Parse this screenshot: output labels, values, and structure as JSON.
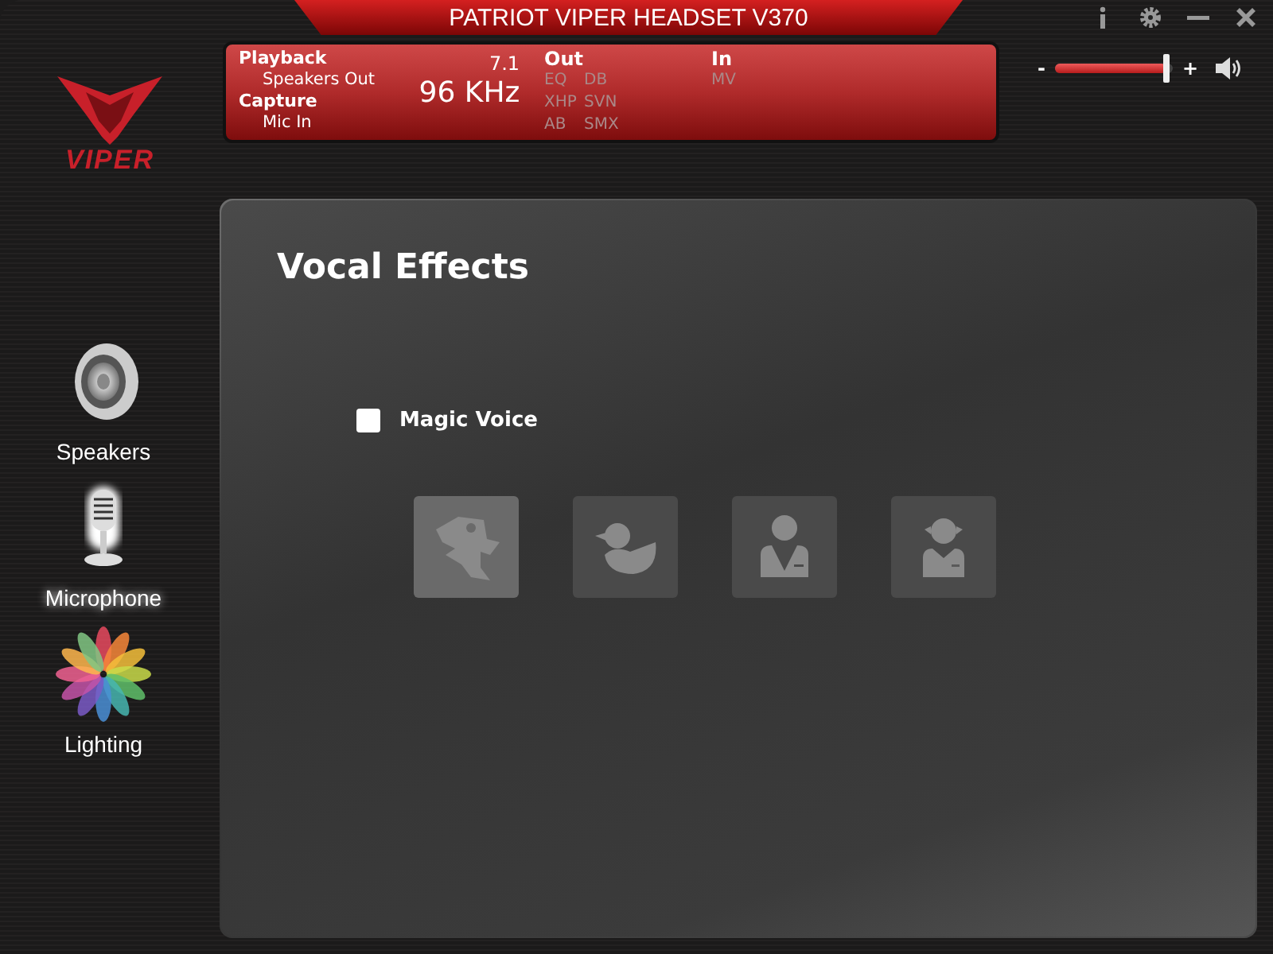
{
  "window": {
    "title": "PATRIOT VIPER HEADSET V370",
    "logo_text": "VIPER"
  },
  "volume": {
    "minus": "-",
    "plus": "+",
    "level": 0.95
  },
  "status": {
    "playback_label": "Playback",
    "playback_device": "Speakers Out",
    "capture_label": "Capture",
    "capture_device": "Mic In",
    "channels": "7.1",
    "sample_rate": "96 KHz",
    "out_label": "Out",
    "out_flags": [
      {
        "label": "EQ",
        "on": false
      },
      {
        "label": "DB",
        "on": false
      },
      {
        "label": "XHP",
        "on": false
      },
      {
        "label": "SVN",
        "on": false
      },
      {
        "label": "AB",
        "on": false
      },
      {
        "label": "SMX",
        "on": false
      }
    ],
    "in_label": "In",
    "in_flags": [
      {
        "label": "MV",
        "on": false
      }
    ]
  },
  "sidebar": {
    "items": [
      {
        "kind": "speakers",
        "label": "Speakers",
        "selected": false
      },
      {
        "kind": "microphone",
        "label": "Microphone",
        "selected": true
      },
      {
        "kind": "lighting",
        "label": "Lighting",
        "selected": false
      }
    ]
  },
  "main": {
    "title": "Vocal Effects",
    "magic_voice": {
      "label": "Magic Voice",
      "checked": false
    },
    "effects": [
      {
        "kind": "monster",
        "selected": true
      },
      {
        "kind": "duck",
        "selected": false
      },
      {
        "kind": "man",
        "selected": false
      },
      {
        "kind": "girl",
        "selected": false
      }
    ]
  }
}
